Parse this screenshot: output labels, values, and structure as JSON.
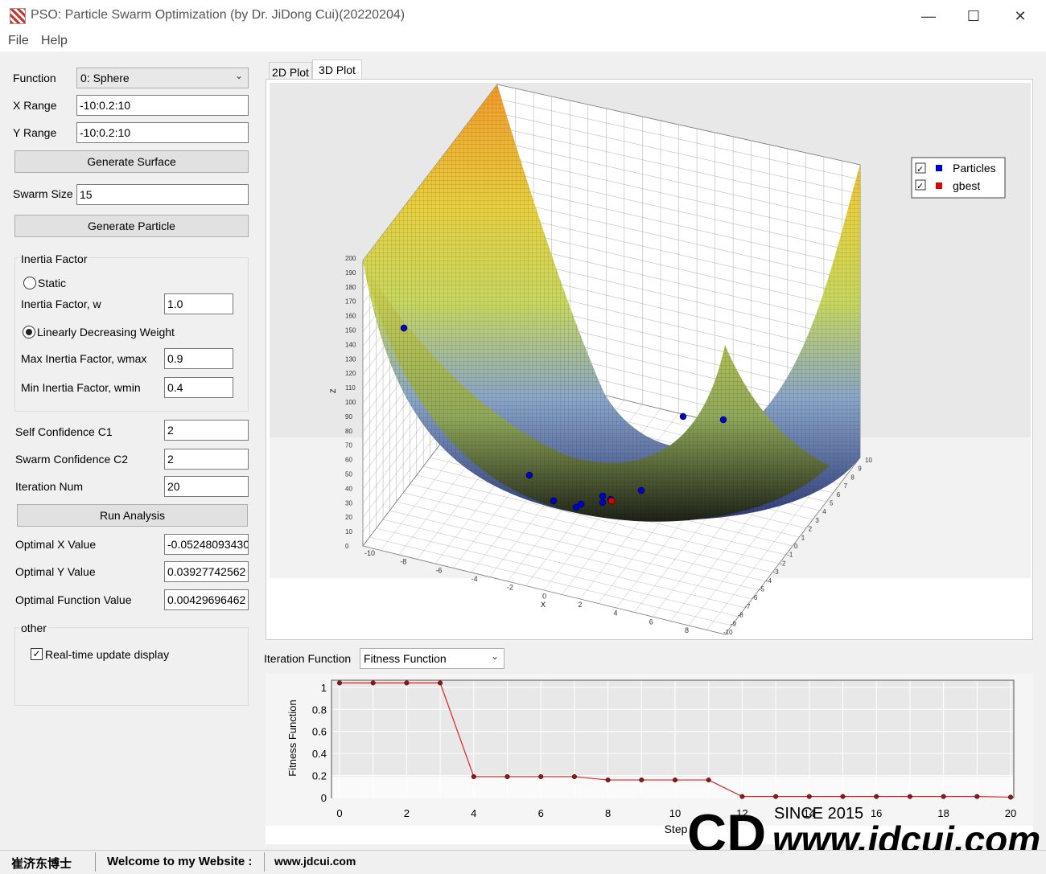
{
  "window": {
    "title": "PSO: Particle Swarm Optimization (by Dr. JiDong Cui)(20220204)",
    "minimize": "—",
    "maximize": "☐",
    "close": "✕"
  },
  "menu": {
    "file": "File",
    "help": "Help"
  },
  "left": {
    "function_label": "Function",
    "function_value": "0: Sphere",
    "xrange_label": "X Range",
    "xrange_value": "-10:0.2:10",
    "yrange_label": "Y Range",
    "yrange_value": "-10:0.2:10",
    "generate_surface": "Generate Surface",
    "swarm_label": "Swarm Size",
    "swarm_value": "15",
    "generate_particle": "Generate Particle",
    "inertia_group": "Inertia Factor",
    "static_label": "Static",
    "w_label": "Inertia Factor, w",
    "w_value": "1.0",
    "ldw_label": "Linearly Decreasing Weight",
    "wmax_label": "Max Inertia Factor, wmax",
    "wmax_value": "0.9",
    "wmin_label": "Min Inertia Factor, wmin",
    "wmin_value": "0.4",
    "c1_label": "Self Confidence C1",
    "c1_value": "2",
    "c2_label": "Swarm Confidence C2",
    "c2_value": "2",
    "iter_label": "Iteration Num",
    "iter_value": "20",
    "run": "Run Analysis",
    "optx_label": "Optimal X Value",
    "optx_value": "-0.05248093430",
    "opty_label": "Optimal Y Value",
    "opty_value": "0.03927742562",
    "optf_label": "Optimal Function Value",
    "optf_value": "0.00429696462",
    "other_group": "other",
    "realtime_label": "Real-time update display"
  },
  "tabs": {
    "plot2d": "2D Plot",
    "plot3d": "3D Plot"
  },
  "plot3d": {
    "zlabel": "Z",
    "xlabel": "X",
    "legend": [
      {
        "label": "Particles",
        "color": "#0000cc"
      },
      {
        "label": "gbest",
        "color": "#dd0000"
      }
    ],
    "z_ticks": [
      "0",
      "10",
      "20",
      "30",
      "40",
      "50",
      "60",
      "70",
      "80",
      "90",
      "100",
      "110",
      "120",
      "130",
      "140",
      "150",
      "160",
      "170",
      "180",
      "190",
      "200"
    ],
    "x_ticks": [
      "-10",
      "-8",
      "-6",
      "-4",
      "-2",
      "0",
      "2",
      "4",
      "6",
      "8"
    ],
    "y_ticks": [
      "-10",
      "-9",
      "-8",
      "-7",
      "-6",
      "-5",
      "-4",
      "-3",
      "-2",
      "-1",
      "0",
      "1",
      "2",
      "3",
      "4",
      "5",
      "6",
      "7",
      "8",
      "9",
      "10"
    ]
  },
  "iteration": {
    "label": "Iteration Function",
    "select": "Fitness Function"
  },
  "chart_data": {
    "type": "line",
    "title": "",
    "xlabel": "Step",
    "ylabel": "Fitness Function",
    "x": [
      0,
      1,
      2,
      3,
      4,
      5,
      6,
      7,
      8,
      9,
      10,
      11,
      12,
      13,
      14,
      15,
      16,
      17,
      18,
      19,
      20
    ],
    "y": [
      1.04,
      1.04,
      1.04,
      1.04,
      0.19,
      0.19,
      0.19,
      0.19,
      0.16,
      0.16,
      0.16,
      0.16,
      0.01,
      0.01,
      0.01,
      0.01,
      0.01,
      0.01,
      0.01,
      0.01,
      0.004
    ],
    "xlim": [
      0,
      20
    ],
    "ylim": [
      0,
      1.05
    ],
    "x_ticks": [
      "0",
      "2",
      "4",
      "6",
      "8",
      "10",
      "12",
      "14",
      "16",
      "18",
      "20"
    ],
    "y_ticks": [
      "0",
      "0.2",
      "0.4",
      "0.6",
      "0.8",
      "1"
    ],
    "color": "#dd2222",
    "grid": true
  },
  "watermark": {
    "since": "SINCE 2015",
    "url": "www.jdcui.com"
  },
  "status": {
    "name": "崔济东博士",
    "welcome": "Welcome to my Website :",
    "site": "www.jdcui.com"
  }
}
